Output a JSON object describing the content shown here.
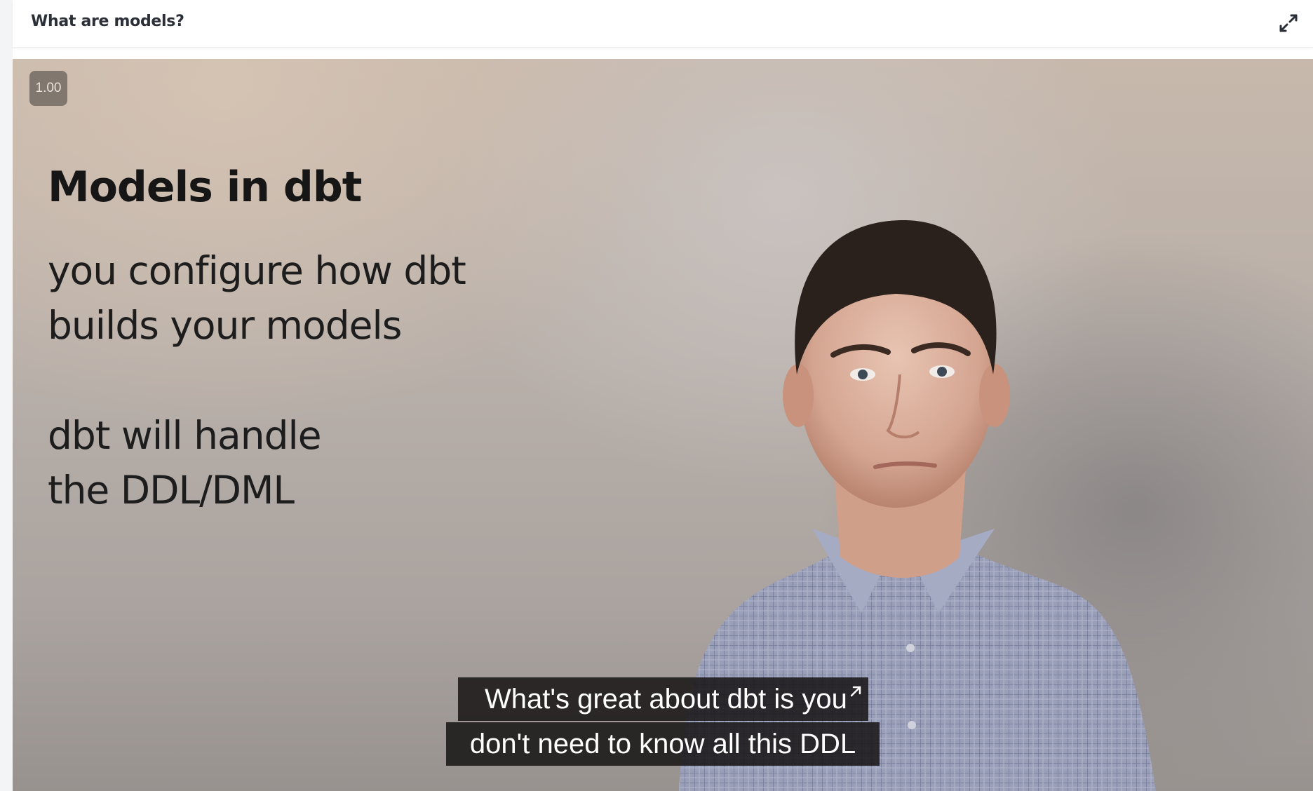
{
  "header": {
    "title": "What are models?",
    "expand_icon": "expand-arrows-icon"
  },
  "video": {
    "playback_speed": "1.00",
    "slide": {
      "title": "Models in dbt",
      "lines": [
        "you configure how dbt",
        "builds your models",
        "dbt will handle",
        "the DDL/DML"
      ]
    },
    "captions": [
      "What's great about dbt is you",
      "don't need to know all this DDL"
    ],
    "caption_icon": "arrow-up-right-icon"
  },
  "colors": {
    "header_text": "#2b2f38",
    "caption_bg": "#161414",
    "caption_text": "#ffffff"
  }
}
